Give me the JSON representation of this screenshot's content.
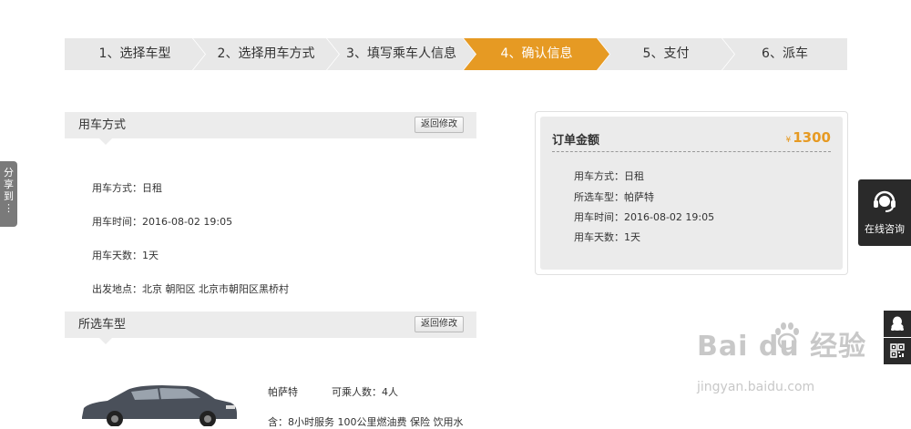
{
  "steps": [
    {
      "label": "1、选择车型"
    },
    {
      "label": "2、选择用车方式"
    },
    {
      "label": "3、填写乘车人信息"
    },
    {
      "label": "4、确认信息",
      "active": true
    },
    {
      "label": "5、支付"
    },
    {
      "label": "6、派车"
    }
  ],
  "usage_section": {
    "title": "用车方式",
    "back_label": "返回修改",
    "lines": [
      "用车方式：日租",
      "用车时间：2016-08-02 19:05",
      "用车天数：1天",
      "出发地点：北京 朝阳区 北京市朝阳区黑桥村"
    ]
  },
  "car_section": {
    "title": "所选车型",
    "back_label": "返回修改",
    "car_name": "帕萨特",
    "seats": "可乘人数：4人",
    "services": "含：8小时服务   100公里燃油费   保险   饮用水"
  },
  "order": {
    "title": "订单金额",
    "currency": "¥",
    "amount": "1300",
    "lines": [
      "用车方式：日租",
      "所选车型：帕萨特",
      "用车时间：2016-08-02 19:05",
      "用车天数：1天"
    ]
  },
  "share_tab": {
    "chars": [
      "分",
      "享",
      "到",
      "⋮"
    ]
  },
  "consult": {
    "label": "在线咨询",
    "icon": "headset-icon"
  },
  "side_buttons": [
    {
      "icon": "qq-icon"
    },
    {
      "icon": "qr-code-icon"
    }
  ],
  "watermark": {
    "main": "Bai du 经验",
    "sub": "jingyan.baidu.com"
  },
  "colors": {
    "accent": "#e69a23",
    "step_bg": "#e8e8e8",
    "section_bg": "#ececec",
    "widget_dark": "#2a2a2a"
  }
}
